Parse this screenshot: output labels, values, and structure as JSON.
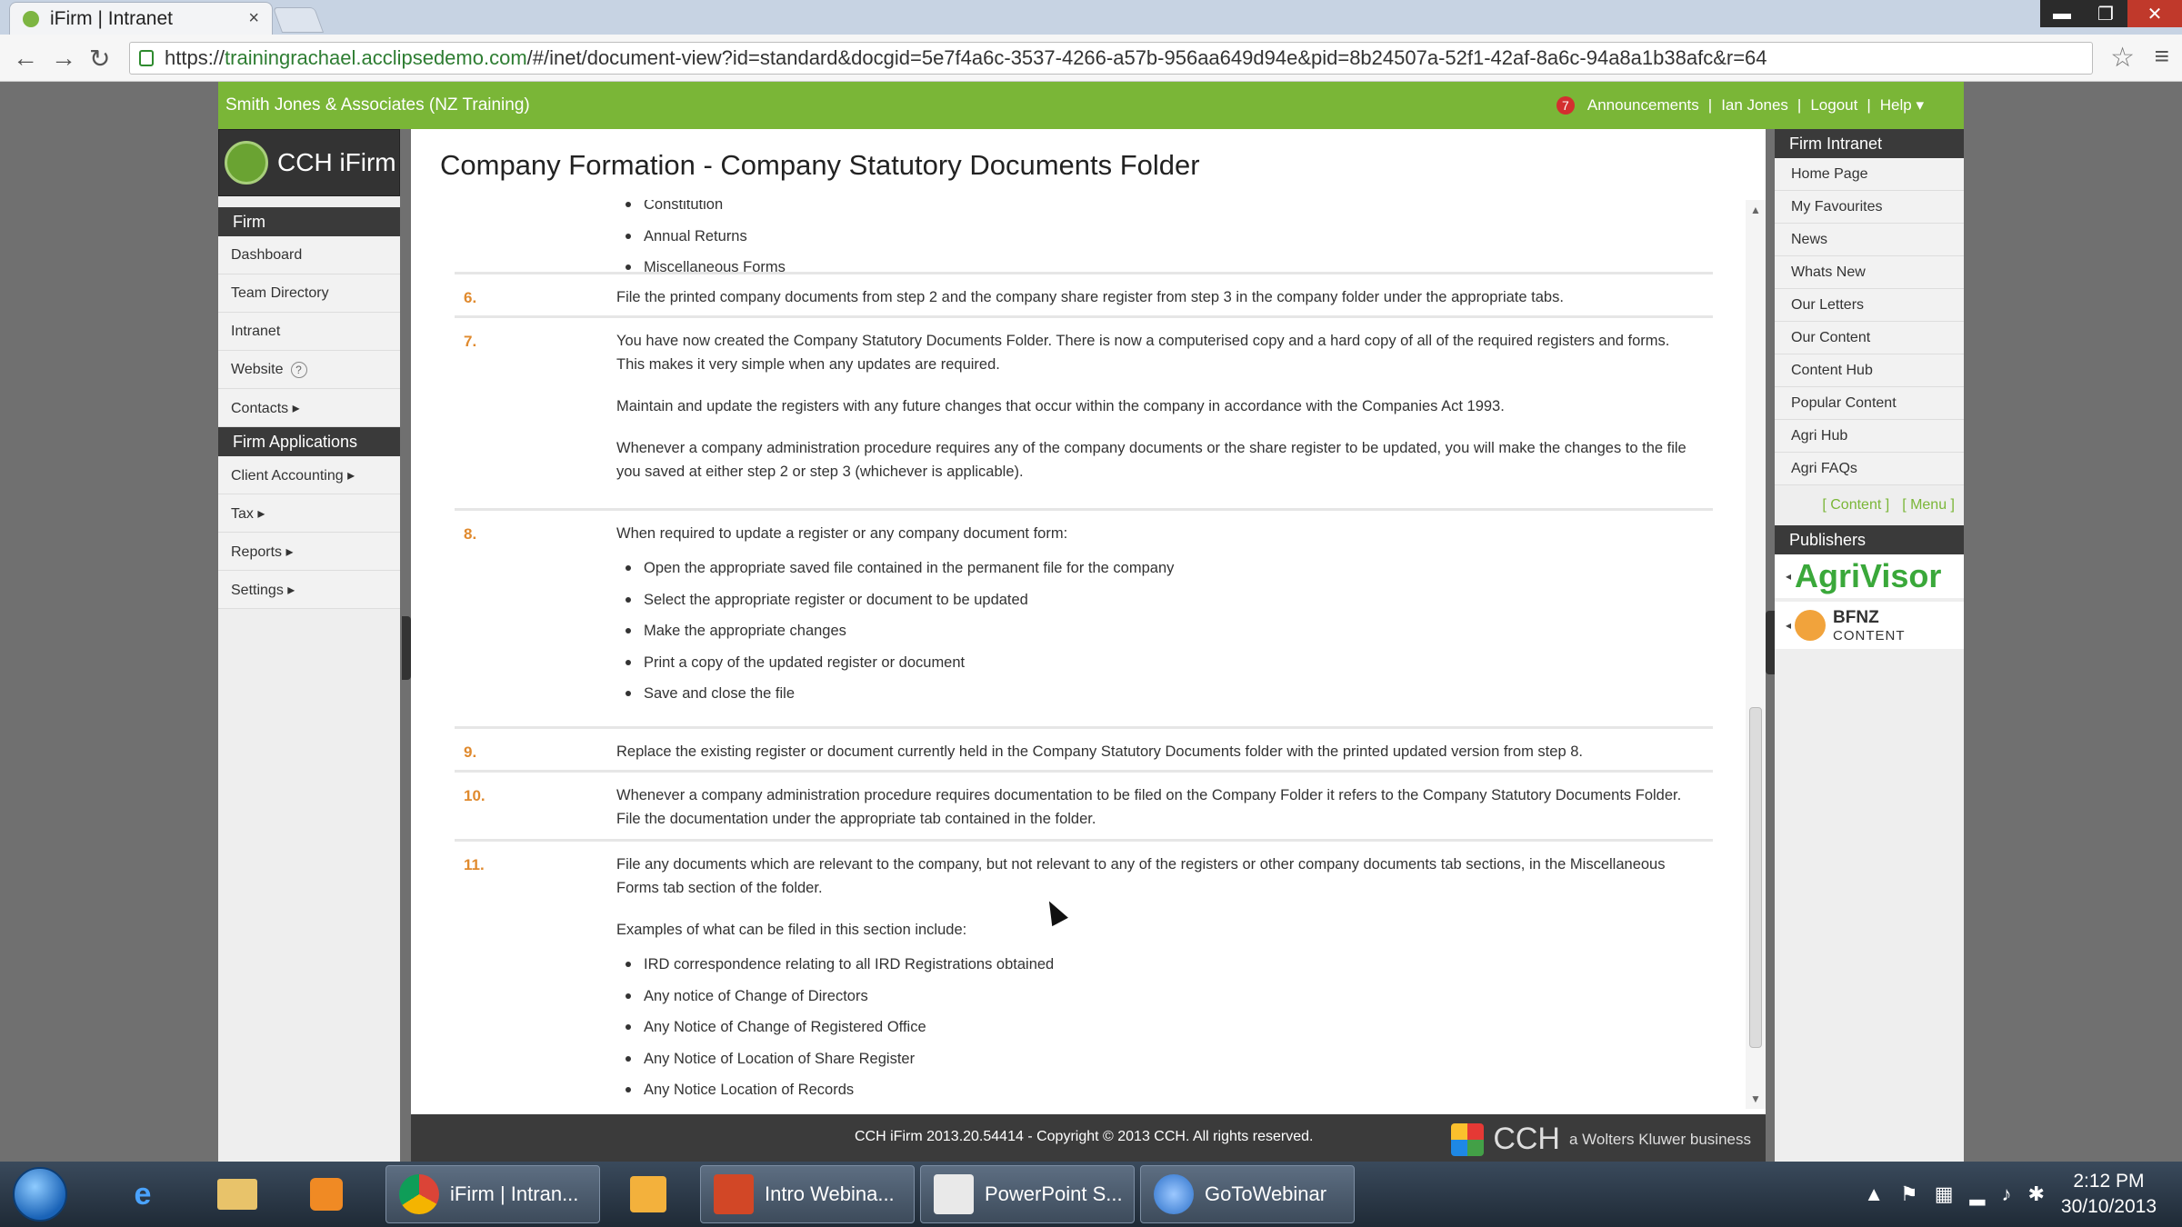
{
  "browser": {
    "tab_title": "iFirm | Intranet",
    "tab_close": "×",
    "url_prefix": "https://",
    "url_host": "trainingrachael.acclipsedemo.com",
    "url_rest": "/#/inet/document-view?id=standard&docgid=5e7f4a6c-3537-4266-a57b-956aa649d94e&pid=8b24507a-52f1-42af-8a6c-94a8a1b38afc&r=64",
    "back": "←",
    "forward": "→",
    "reload": "↻",
    "star": "☆",
    "menu": "≡",
    "win_min": "▬",
    "win_max": "❐",
    "win_close": "✕"
  },
  "header": {
    "firm_name": "Smith Jones & Associates (NZ Training)",
    "badge": "7",
    "announcements": "Announcements",
    "user": "Ian Jones",
    "logout": "Logout",
    "help": "Help ▾",
    "sep": "|"
  },
  "logo_text": "CCH iFirm",
  "left_nav": {
    "section1": "Firm",
    "items1": [
      "Dashboard",
      "Team Directory",
      "Intranet",
      "Website",
      "Contacts ▸"
    ],
    "website_help": "?",
    "section2": "Firm Applications",
    "items2": [
      "Client Accounting ▸",
      "Tax ▸",
      "Reports ▸",
      "Settings ▸"
    ]
  },
  "page_title": "Company Formation - Company Statutory Documents Folder",
  "doc": {
    "top_bullets": [
      "Constitution",
      "Annual Returns",
      "Miscellaneous Forms"
    ],
    "steps": [
      {
        "num": "6.",
        "paras": [
          "File the printed company documents from step 2 and the company share register from step 3 in the company folder under the appropriate tabs."
        ]
      },
      {
        "num": "7.",
        "paras": [
          "You have now created the Company Statutory Documents Folder. There is now a computerised copy and a hard copy of all of the required registers and forms.  This makes it very simple when any updates are required.",
          "Maintain and update the registers with any future changes that occur within the company in accordance with the Companies Act 1993.",
          "Whenever a company administration procedure requires any of the company documents or the share register to be updated, you will make the changes to the file you saved at either step 2 or step 3 (whichever is applicable)."
        ]
      },
      {
        "num": "8.",
        "paras": [
          "When required to update a register or any company document form:"
        ],
        "bullets": [
          "Open the appropriate saved file contained in the permanent file for the company",
          "Select the appropriate register or document to be updated",
          "Make the appropriate changes",
          "Print a copy of the updated register or document",
          "Save and close the file"
        ]
      },
      {
        "num": "9.",
        "paras": [
          "Replace the existing register or document currently held in the Company Statutory Documents folder with the printed updated version from step 8."
        ]
      },
      {
        "num": "10.",
        "paras": [
          "Whenever a company administration procedure requires documentation to be filed on the Company Folder it refers to the Company Statutory Documents Folder.  File the documentation under the appropriate tab contained in the folder."
        ]
      },
      {
        "num": "11.",
        "paras": [
          "File any documents which are relevant to the company, but not relevant to any of the registers or other company documents tab sections, in the Miscellaneous Forms tab section of the folder.",
          "Examples of what can be filed in this section include:"
        ],
        "bullets": [
          "IRD correspondence relating to all IRD Registrations obtained",
          "Any notice of Change of Directors",
          "Any Notice of Change of Registered Office",
          "Any Notice of Location of Share Register",
          "Any Notice Location of Records"
        ]
      }
    ]
  },
  "right_nav": {
    "section1": "Firm Intranet",
    "items": [
      "Home Page",
      "My Favourites",
      "News",
      "Whats New",
      "Our Letters",
      "Our Content",
      "Content Hub",
      "Popular Content",
      "Agri Hub",
      "Agri FAQs"
    ],
    "content_link": "[ Content ]",
    "menu_link": "[ Menu ]",
    "section2": "Publishers",
    "agrivisor": "AgriVisor",
    "bfnz_1": "BFNZ",
    "bfnz_2": "CONTENT"
  },
  "footer": {
    "copyright": "CCH iFirm 2013.20.54414 - Copyright © 2013 CCH. All rights reserved.",
    "brand": "CCH",
    "tagline": "a Wolters Kluwer business"
  },
  "taskbar": {
    "buttons": [
      "iFirm | Intran...",
      "Intro Webina...",
      "PowerPoint S...",
      "GoToWebinar"
    ],
    "time": "2:12 PM",
    "date": "30/10/2013"
  }
}
